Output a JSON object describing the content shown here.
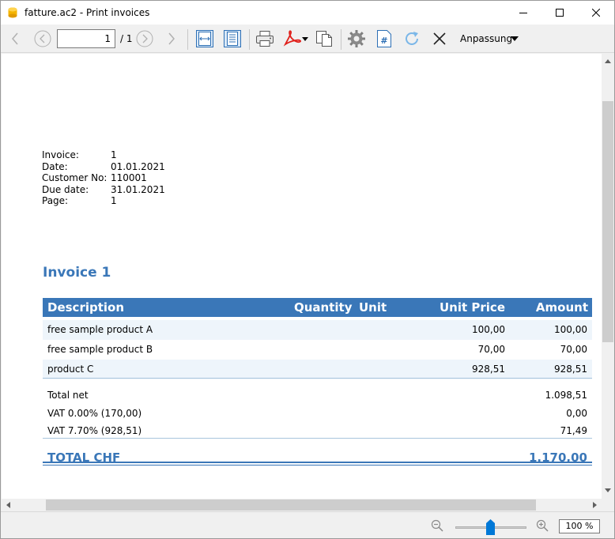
{
  "window": {
    "title": "fatture.ac2 - Print invoices"
  },
  "toolbar": {
    "page_current": "1",
    "page_total": "/ 1",
    "zoom_mode": "Anpassung"
  },
  "invoice": {
    "meta": [
      {
        "label": "Invoice:",
        "value": "1"
      },
      {
        "label": "Date:",
        "value": "01.01.2021"
      },
      {
        "label": "Customer No:",
        "value": "110001"
      },
      {
        "label": "Due date:",
        "value": "31.01.2021"
      },
      {
        "label": "Page:",
        "value": "1"
      }
    ],
    "title": "Invoice 1",
    "columns": {
      "description": "Description",
      "quantity": "Quantity",
      "unit": "Unit",
      "unit_price": "Unit Price",
      "amount": "Amount"
    },
    "items": [
      {
        "description": "free sample product A",
        "unit_price": "100,00",
        "amount": "100,00"
      },
      {
        "description": "free sample product B",
        "unit_price": "70,00",
        "amount": "70,00"
      },
      {
        "description": "product C",
        "unit_price": "928,51",
        "amount": "928,51"
      }
    ],
    "totals": [
      {
        "label": "Total net",
        "value": "1.098,51"
      },
      {
        "label": "VAT 0.00% (170,00)",
        "value": "0,00"
      },
      {
        "label": "VAT 7.70% (928,51)",
        "value": "71,49"
      }
    ],
    "grand_total": {
      "label": "TOTAL CHF",
      "value": "1.170,00"
    }
  },
  "statusbar": {
    "zoom_value": "100 %",
    "zoom_level_percent": 50
  },
  "colors": {
    "accent": "#3a77b8",
    "row_alt": "#eef5fb"
  }
}
